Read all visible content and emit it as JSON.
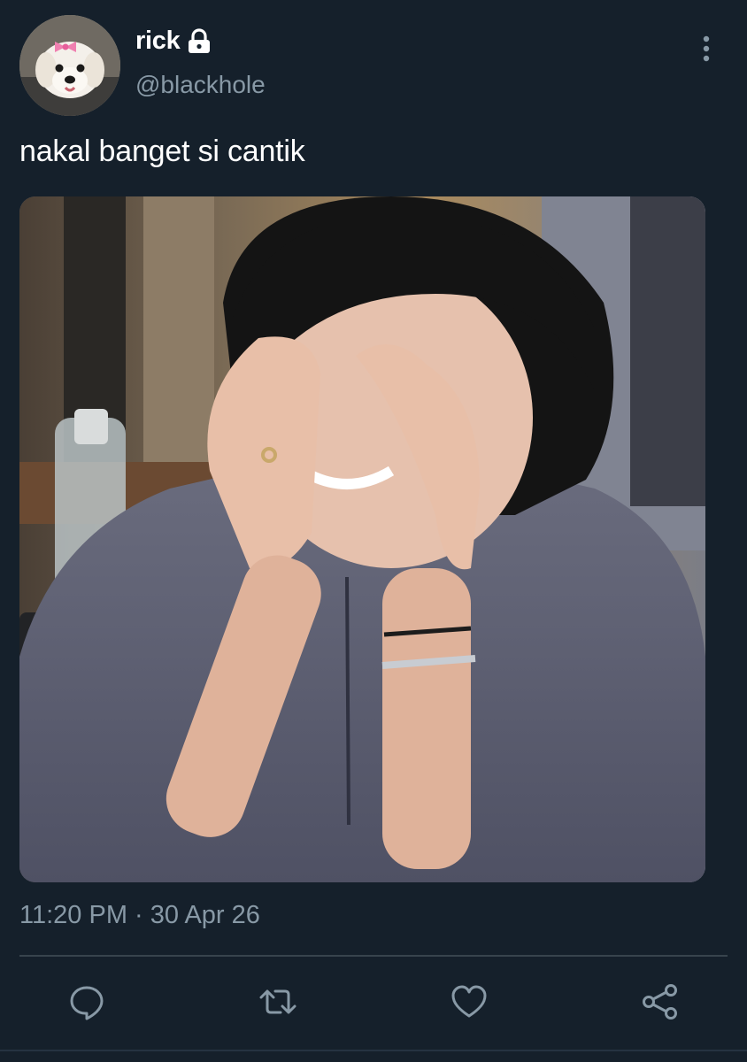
{
  "tweet": {
    "display_name": "rick",
    "handle": "@blackhole",
    "text": "nakal banget si cantik",
    "timestamp": "11:20 PM · 30 Apr 26",
    "protected": true
  },
  "icons": {
    "avatar": "avatar-dog-photo",
    "lock": "lock-icon",
    "more": "vertical-ellipsis-icon",
    "reply": "reply-icon",
    "retweet": "retweet-icon",
    "like": "heart-icon",
    "share": "share-icon"
  },
  "colors": {
    "background": "#15202b",
    "primary_text": "#ffffff",
    "secondary_text": "#8899a6",
    "divider": "#38444d"
  }
}
